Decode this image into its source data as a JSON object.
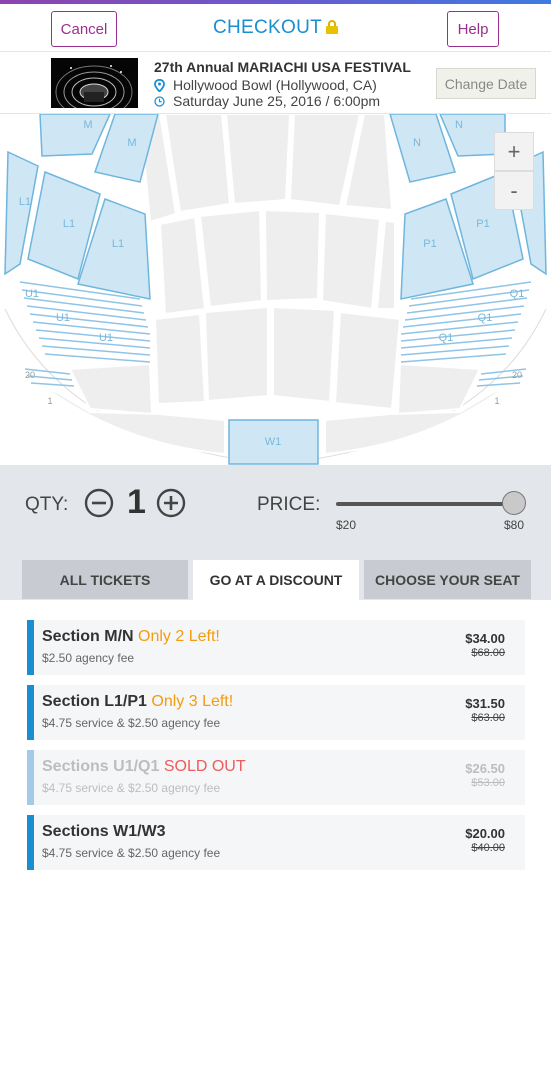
{
  "header": {
    "cancel_label": "Cancel",
    "title": "CHECKOUT",
    "help_label": "Help"
  },
  "event": {
    "title": "27th Annual MARIACHI USA FESTIVAL",
    "venue": "Hollywood Bowl (Hollywood, CA)",
    "datetime": "Saturday June 25, 2016 / 6:00pm",
    "change_date_label": "Change Date"
  },
  "map": {
    "zoom_in_label": "+",
    "zoom_out_label": "-",
    "section_labels": {
      "m1": "M",
      "m2": "M",
      "n1": "N",
      "n2": "N",
      "l1a": "L1",
      "l1b": "L1",
      "l1c": "L1",
      "p1a": "P1",
      "p1b": "P1",
      "u1a": "U1",
      "u1b": "U1",
      "u1c": "U1",
      "q1a": "Q1",
      "q1b": "Q1",
      "q1c": "Q1",
      "w1": "W1",
      "row20l": "20",
      "row20r": "20",
      "row1l": "1",
      "row1r": "1"
    },
    "colors": {
      "available": "#cfe6f5",
      "available_stroke": "#6fb6dd",
      "unavailable": "#eeeeee"
    }
  },
  "controls": {
    "qty_label": "QTY:",
    "qty_value": "1",
    "price_label": "PRICE:",
    "price_min": "$20",
    "price_max": "$80",
    "price_slider_level": 1.0
  },
  "tabs": [
    {
      "label": "ALL TICKETS",
      "active": false
    },
    {
      "label": "GO AT A DISCOUNT",
      "active": true
    },
    {
      "label": "CHOOSE YOUR SEAT",
      "active": false
    }
  ],
  "listings": [
    {
      "name": "Section M/N",
      "note": "Only 2 Left!",
      "fee": "$2.50 agency fee",
      "price": "$34.00",
      "orig_price": "$68.00",
      "sold_out": false
    },
    {
      "name": "Section L1/P1",
      "note": "Only 3 Left!",
      "fee": "$4.75 service & $2.50 agency fee",
      "price": "$31.50",
      "orig_price": "$63.00",
      "sold_out": false
    },
    {
      "name": "Sections U1/Q1",
      "note": "SOLD OUT",
      "fee": "$4.75 service & $2.50 agency fee",
      "price": "$26.50",
      "orig_price": "$53.00",
      "sold_out": true
    },
    {
      "name": "Sections W1/W3",
      "note": "",
      "fee": "$4.75 service & $2.50 agency fee",
      "price": "$20.00",
      "orig_price": "$40.00",
      "sold_out": false
    }
  ]
}
